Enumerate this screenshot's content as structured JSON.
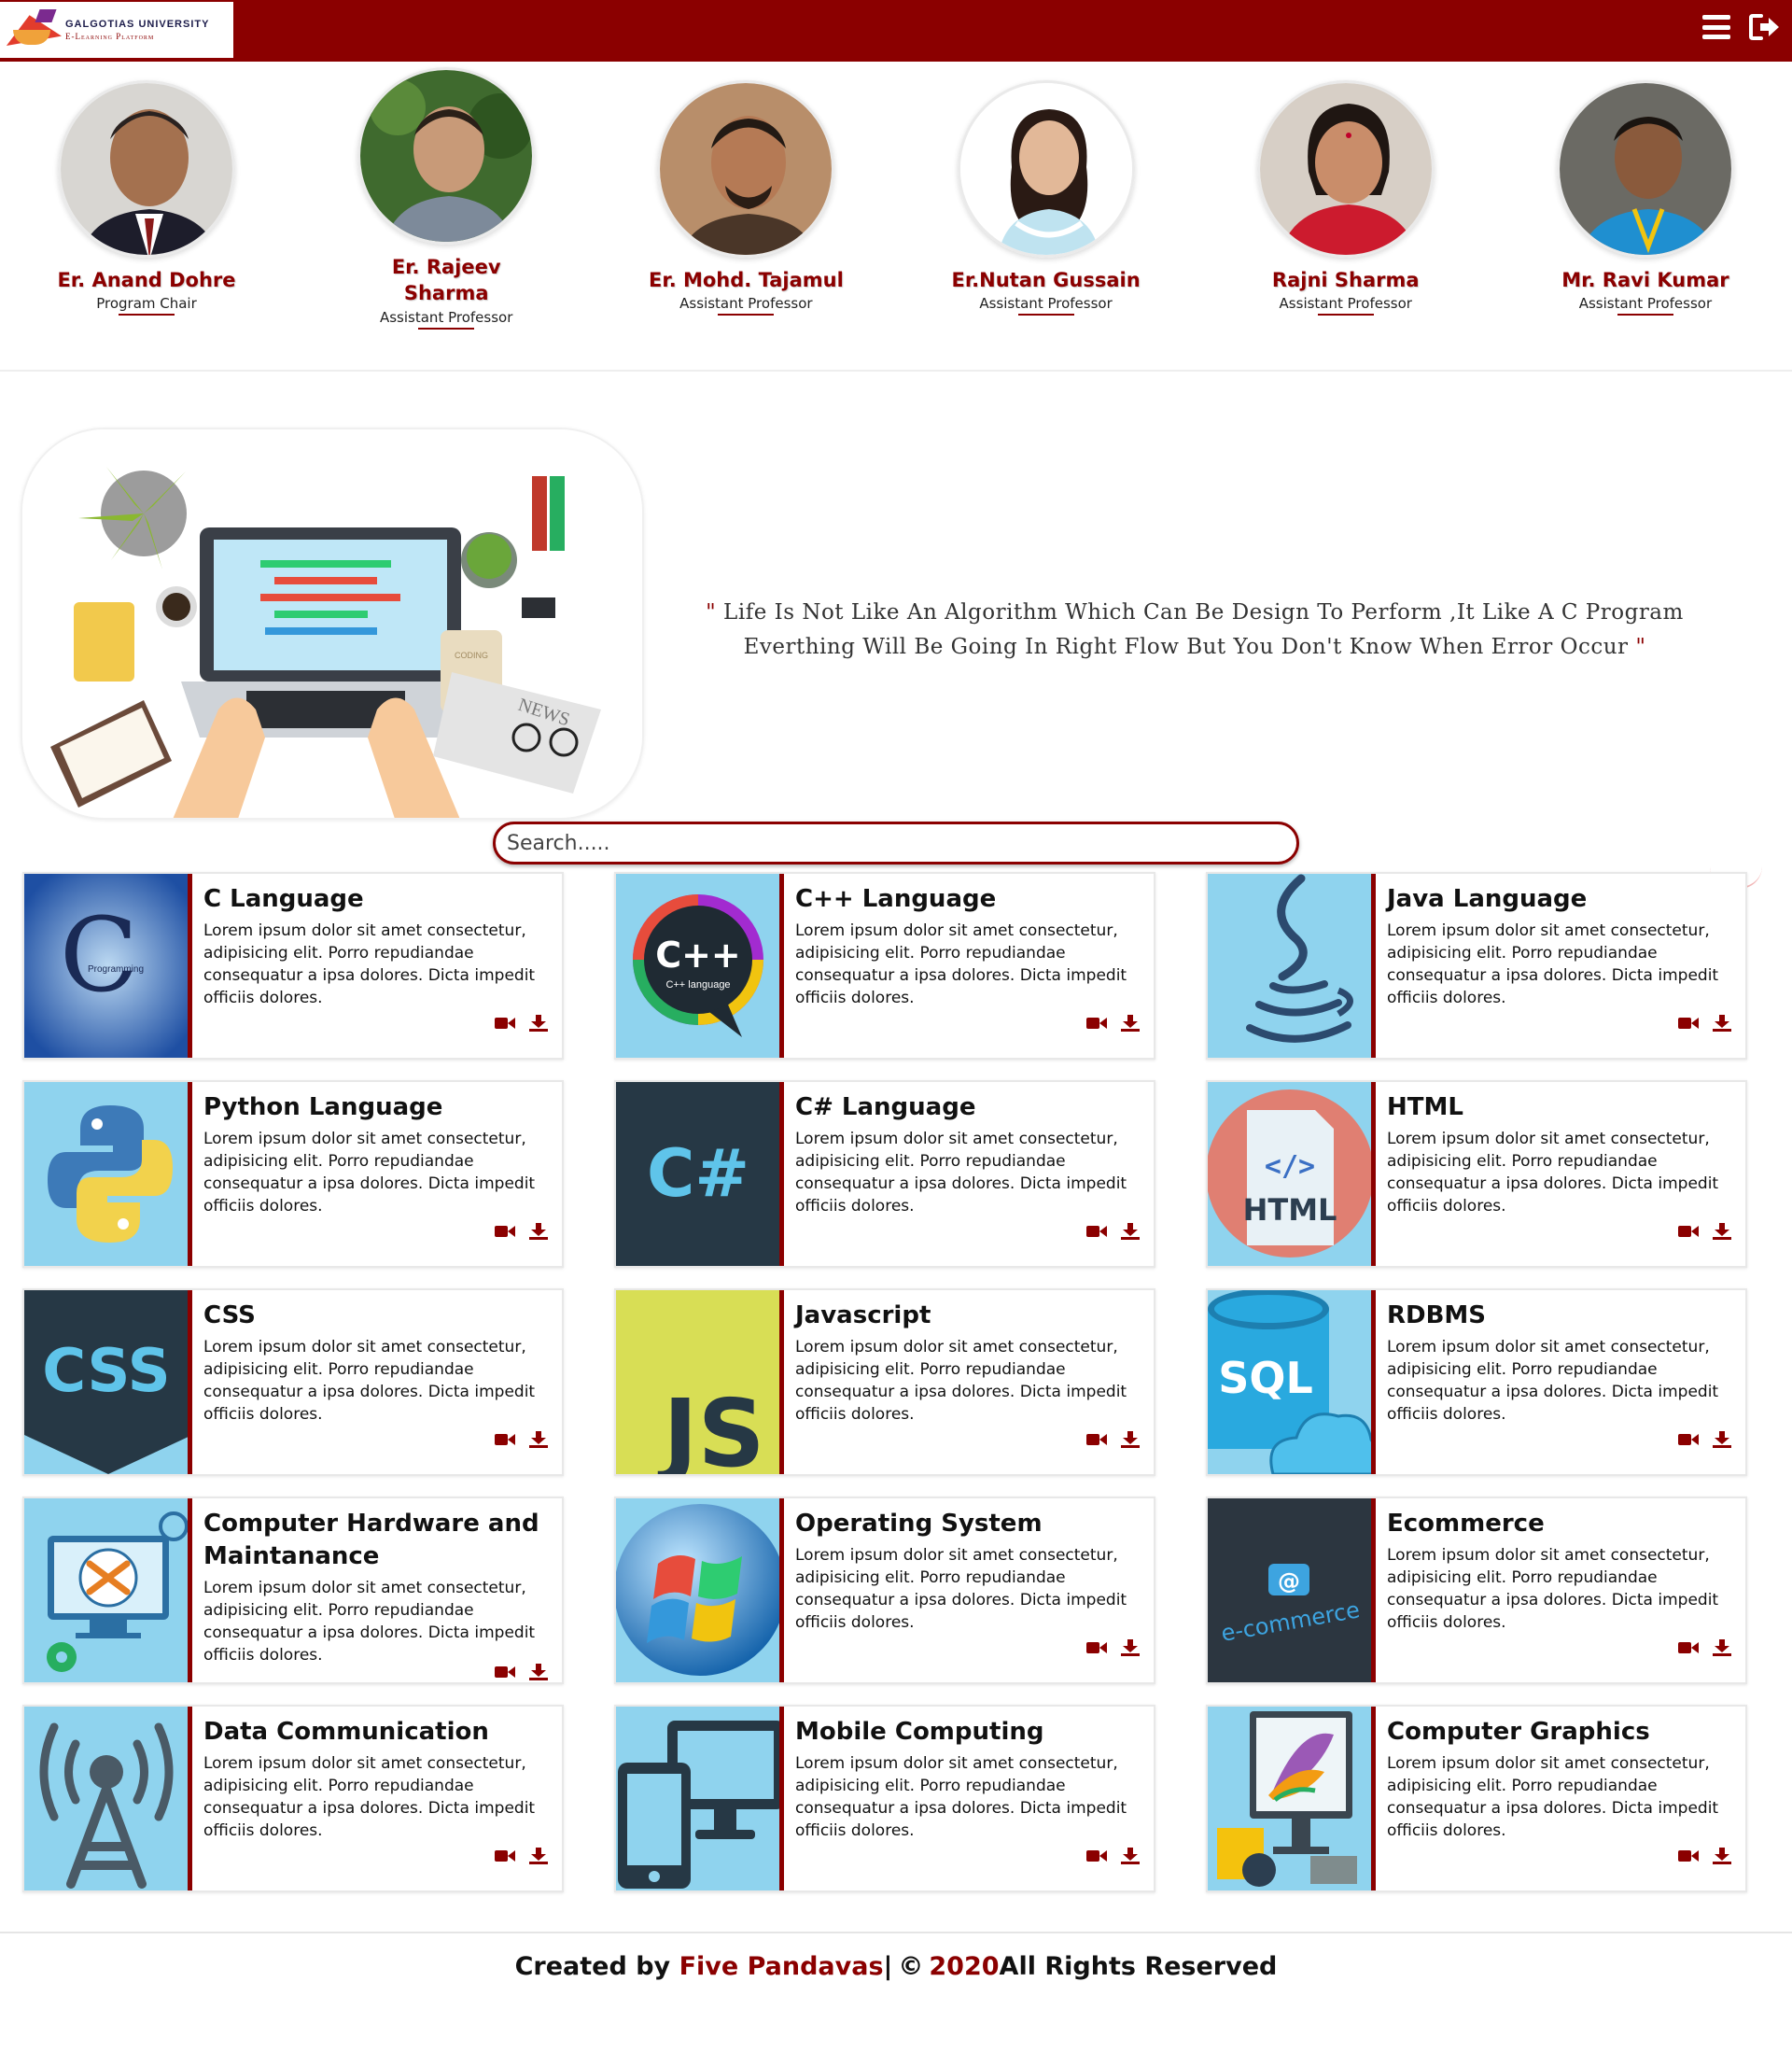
{
  "header": {
    "logo_line1": "GALGOTIAS UNIVERSITY",
    "logo_line2": "E-Learning Platform",
    "brand_color": "#8b0000",
    "menu_icon": "hamburger-menu-icon",
    "logout_icon": "sign-out-icon"
  },
  "faculty": [
    {
      "name": "Er. Anand Dohre",
      "role": "Program Chair"
    },
    {
      "name": "Er. Rajeev Sharma",
      "role": "Assistant Professor"
    },
    {
      "name": "Er. Mohd. Tajamul",
      "role": "Assistant Professor"
    },
    {
      "name": "Er.Nutan Gussain",
      "role": "Assistant Professor"
    },
    {
      "name": "Rajni Sharma",
      "role": "Assistant Professor"
    },
    {
      "name": "Mr. Ravi Kumar",
      "role": "Assistant Professor"
    }
  ],
  "hero": {
    "quote_open": "\"",
    "quote_text": " Life Is Not Like An Algorithm Which Can Be Design To Perform ,It Like A C Program Everthing Will Be Going In Right Flow But You Don't Know When Error Occur ",
    "quote_close": "\"",
    "illustration_labels": {
      "notebook": "CODING",
      "newspaper": "NEWS"
    }
  },
  "search": {
    "placeholder": "Search....."
  },
  "courses": [
    {
      "title": "C Language",
      "desc": "Lorem ipsum dolor sit amet consectetur, adipisicing elit. Porro repudiandae consequatur a ipsa dolores. Dicta impedit officiis dolores.",
      "thumb_text": "C",
      "thumb_sub": "Programming"
    },
    {
      "title": "C++ Language",
      "desc": "Lorem ipsum dolor sit amet consectetur, adipisicing elit. Porro repudiandae consequatur a ipsa dolores. Dicta impedit officiis dolores.",
      "thumb_text": "C++",
      "thumb_sub": "C++ language"
    },
    {
      "title": "Java Language",
      "desc": "Lorem ipsum dolor sit amet consectetur, adipisicing elit. Porro repudiandae consequatur a ipsa dolores. Dicta impedit officiis dolores."
    },
    {
      "title": "Python Language",
      "desc": "Lorem ipsum dolor sit amet consectetur, adipisicing elit. Porro repudiandae consequatur a ipsa dolores. Dicta impedit officiis dolores."
    },
    {
      "title": "C# Language",
      "desc": "Lorem ipsum dolor sit amet consectetur, adipisicing elit. Porro repudiandae consequatur a ipsa dolores. Dicta impedit officiis dolores.",
      "thumb_text": "C#"
    },
    {
      "title": "HTML",
      "desc": "Lorem ipsum dolor sit amet consectetur, adipisicing elit. Porro repudiandae consequatur a ipsa dolores. Dicta impedit officiis dolores.",
      "thumb_text": "HTML",
      "thumb_sub": "</>"
    },
    {
      "title": "CSS",
      "desc": "Lorem ipsum dolor sit amet consectetur, adipisicing elit. Porro repudiandae consequatur a ipsa dolores. Dicta impedit officiis dolores.",
      "thumb_text": "CSS"
    },
    {
      "title": "Javascript",
      "desc": "Lorem ipsum dolor sit amet consectetur, adipisicing elit. Porro repudiandae consequatur a ipsa dolores. Dicta impedit officiis dolores.",
      "thumb_text": "JS"
    },
    {
      "title": "RDBMS",
      "desc": "Lorem ipsum dolor sit amet consectetur, adipisicing elit. Porro repudiandae consequatur a ipsa dolores. Dicta impedit officiis dolores.",
      "thumb_text": "SQL"
    },
    {
      "title": "Computer Hardware and Maintanance",
      "desc": "Lorem ipsum dolor sit amet consectetur, adipisicing elit. Porro repudiandae consequatur a ipsa dolores. Dicta impedit officiis dolores."
    },
    {
      "title": "Operating System",
      "desc": "Lorem ipsum dolor sit amet consectetur, adipisicing elit. Porro repudiandae consequatur a ipsa dolores. Dicta impedit officiis dolores."
    },
    {
      "title": "Ecommerce",
      "desc": "Lorem ipsum dolor sit amet consectetur, adipisicing elit. Porro repudiandae consequatur a ipsa dolores. Dicta impedit officiis dolores.",
      "thumb_text": "e-commerce",
      "thumb_sub": "@"
    },
    {
      "title": "Data Communication",
      "desc": "Lorem ipsum dolor sit amet consectetur, adipisicing elit. Porro repudiandae consequatur a ipsa dolores. Dicta impedit officiis dolores."
    },
    {
      "title": "Mobile Computing",
      "desc": "Lorem ipsum dolor sit amet consectetur, adipisicing elit. Porro repudiandae consequatur a ipsa dolores. Dicta impedit officiis dolores."
    },
    {
      "title": "Computer Graphics",
      "desc": "Lorem ipsum dolor sit amet consectetur, adipisicing elit. Porro repudiandae consequatur a ipsa dolores. Dicta impedit officiis dolores."
    }
  ],
  "course_actions": {
    "video_icon": "video-camera-icon",
    "download_icon": "download-icon"
  },
  "footer": {
    "prefix": "Created by ",
    "team": "Five Pandavas",
    "sep": " | ",
    "copy_symbol": "©",
    "year": "2020",
    "suffix": " All Rights Reserved"
  }
}
